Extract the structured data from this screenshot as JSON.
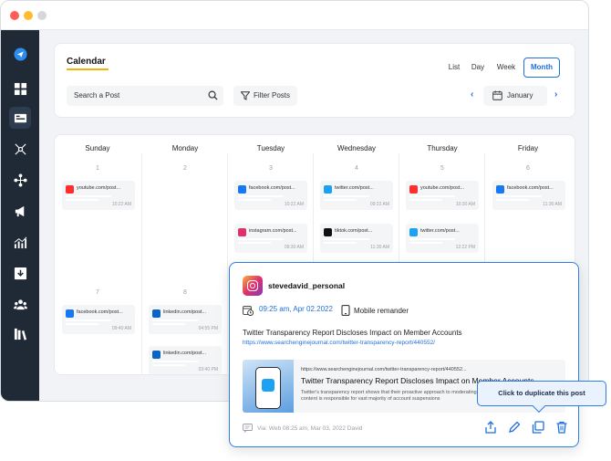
{
  "window": {
    "dot_colors": [
      "#ff5f57",
      "#febc2e",
      "#d5d7db"
    ]
  },
  "sidebar": {
    "items": [
      {
        "icon": "paper-plane-icon",
        "active": true
      },
      {
        "icon": "dashboard-grid-icon"
      },
      {
        "icon": "calendar-posts-icon",
        "active": true
      },
      {
        "icon": "network-nodes-icon"
      },
      {
        "icon": "connections-icon"
      },
      {
        "icon": "megaphone-icon"
      },
      {
        "icon": "analytics-bars-icon"
      },
      {
        "icon": "download-icon"
      },
      {
        "icon": "team-users-icon"
      },
      {
        "icon": "library-books-icon"
      }
    ]
  },
  "header": {
    "title": "Calendar",
    "search_placeholder": "Search a Post",
    "filter_label": "Filter Posts",
    "views": [
      "List",
      "Day",
      "Week",
      "Month"
    ],
    "active_view": "Month",
    "month": "January"
  },
  "calendar": {
    "days": [
      "Sunday",
      "Monday",
      "Tuesday",
      "Wednesday",
      "Thursday",
      "Friday"
    ],
    "week1_dates": [
      "1",
      "2",
      "3",
      "4",
      "5",
      "6"
    ],
    "week2_dates": [
      "7",
      "8"
    ],
    "posts": [
      {
        "network": "youtube",
        "label": "youtube.com/post...",
        "time": "10:22 AM"
      },
      {
        "network": "facebook",
        "label": "facebook.com/post...",
        "time": "10:22 AM"
      },
      {
        "network": "twitter",
        "label": "twitter.com/post...",
        "time": "09:22 AM"
      },
      {
        "network": "youtube",
        "label": "youtube.com/post...",
        "time": "10:30 AM"
      },
      {
        "network": "facebook",
        "label": "facebook.com/post...",
        "time": "11:30 AM"
      },
      {
        "network": "instagram",
        "label": "instagram.com/post...",
        "time": "09:30 AM"
      },
      {
        "network": "tiktok",
        "label": "tiktok.com/post...",
        "time": "11:30 AM"
      },
      {
        "network": "twitter",
        "label": "twitter.com/post...",
        "time": "12:22 PM"
      },
      {
        "network": "facebook",
        "label": "facebook.com/post...",
        "time": "09:40 AM"
      },
      {
        "network": "linkedin",
        "label": "linkedin.com/post...",
        "time": "04:55 PM"
      },
      {
        "network": "linkedin",
        "label": "linkedin.com/post...",
        "time": "03:40 PM"
      }
    ]
  },
  "post_detail": {
    "username": "stevedavid_personal",
    "scheduled": "09:25 am, Apr 02.2022",
    "reminder": "Mobile remander",
    "headline": "Twitter Transparency Report Discloses Impact on Member Accounts",
    "url": "https://www.searchenginejournal.com/twitter-transparency-report/440552/",
    "preview": {
      "url": "https://www.searchenginejournal.com/twitter-transparency-report/440552...",
      "title": "Twitter Transparency Report Discloses Impact on Member Accounts",
      "description": "Twitter's transparency report shows that their proactive approach to moderating content is responsible for vast majority of account suspensions"
    },
    "footer": "Via: Web  08:25 am, Mar 03, 2022  David",
    "tooltip": "Click to duplicate this post"
  },
  "colors": {
    "accent": "#1f6fe0",
    "sidebar_bg": "#1f2a36",
    "title_underline": "#f2b400",
    "youtube": "#ff2d2d",
    "facebook": "#1877f2",
    "twitter": "#1da1f2",
    "tiktok": "#111111",
    "linkedin": "#0a66c2",
    "instagram": "#e1306c"
  }
}
